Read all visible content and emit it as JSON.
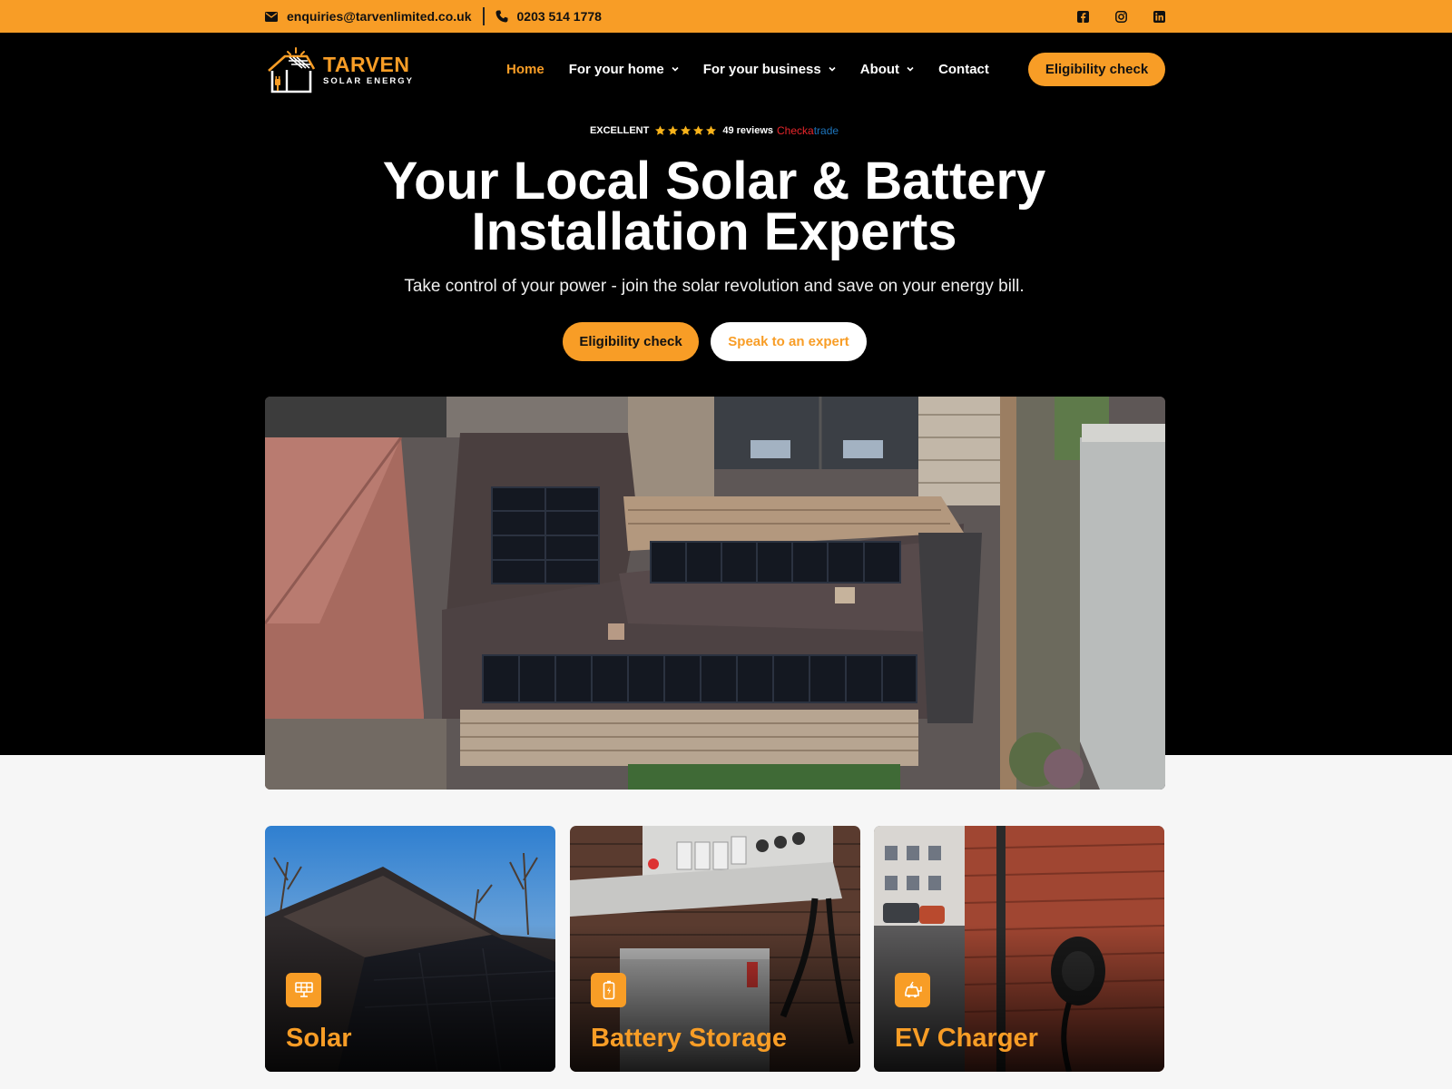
{
  "topbar": {
    "email": "enquiries@tarvenlimited.co.uk",
    "phone": "0203 514 1778",
    "socials": [
      "facebook-icon",
      "instagram-icon",
      "linkedin-icon"
    ]
  },
  "logo": {
    "name": "TARVEN",
    "tagline": "SOLAR ENERGY"
  },
  "nav": {
    "items": [
      {
        "label": "Home",
        "active": true
      },
      {
        "label": "For your home",
        "dropdown": true
      },
      {
        "label": "For your business",
        "dropdown": true
      },
      {
        "label": "About",
        "dropdown": true
      },
      {
        "label": "Contact"
      }
    ],
    "cta": "Eligibility check"
  },
  "rating": {
    "label": "EXCELLENT",
    "stars": 5,
    "reviews": "49 reviews",
    "provider_part1": "Checka",
    "provider_part2": "trade"
  },
  "hero": {
    "headline_line1": "Your Local Solar & Battery",
    "headline_line2": "Installation Experts",
    "subheadline": "Take control of your power - join the solar revolution and save on your energy bill.",
    "primary_button": "Eligibility check",
    "secondary_button": "Speak to an expert"
  },
  "cards": [
    {
      "title": "Solar",
      "icon": "solar-panel-icon"
    },
    {
      "title": "Battery Storage",
      "icon": "battery-icon"
    },
    {
      "title": "EV Charger",
      "icon": "ev-car-icon"
    }
  ],
  "colors": {
    "accent": "#f89d26",
    "dark": "#000000",
    "light_bg": "#f6f6f6"
  }
}
